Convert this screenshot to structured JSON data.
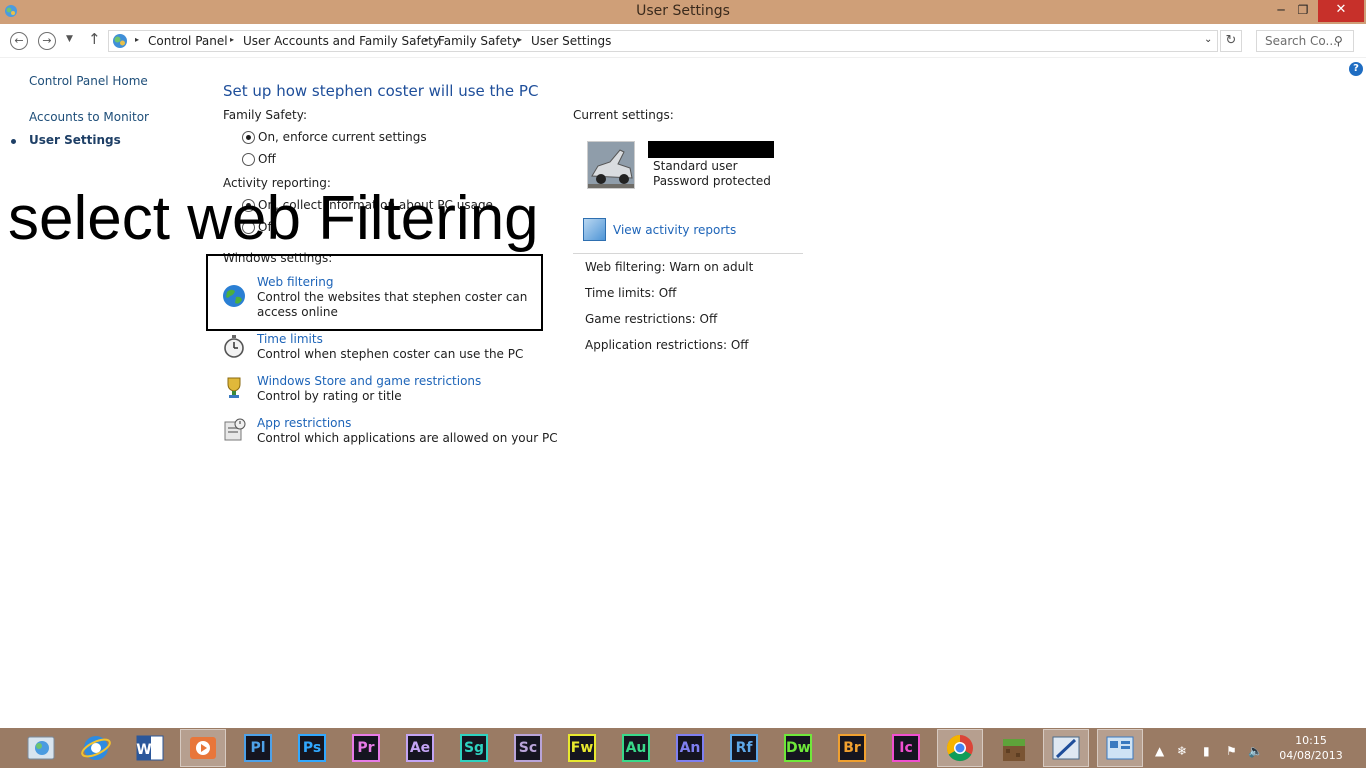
{
  "window": {
    "title": "User Settings",
    "minimize_glyph": "─",
    "maximize_glyph": "❐",
    "close_glyph": "✕"
  },
  "navbar": {
    "back_glyph": "←",
    "forward_glyph": "→",
    "recent_glyph": "▼",
    "up_glyph": "↑",
    "breadcrumbs": [
      "Control Panel",
      "User Accounts and Family Safety",
      "Family Safety",
      "User Settings"
    ],
    "separator_glyph": "▸",
    "dropdown_glyph": "⌄",
    "refresh_glyph": "↻",
    "search_placeholder": "Search Co...",
    "search_glyph": "⚲"
  },
  "sidebar": {
    "items": [
      {
        "label": "Control Panel Home"
      },
      {
        "label": "Accounts to Monitor"
      },
      {
        "label": "User Settings"
      }
    ],
    "help_glyph": "?"
  },
  "main": {
    "heading": "Set up how stephen coster will use the PC",
    "family_safety": {
      "label": "Family Safety:",
      "options": [
        "On, enforce current settings",
        "Off"
      ],
      "selected": "On, enforce current settings"
    },
    "activity_reporting": {
      "label": "Activity reporting:",
      "options": [
        "On, collect information about PC usage",
        "Off"
      ],
      "selected": "On, collect information about PC usage"
    },
    "windows_settings": {
      "label": "Windows settings:",
      "items": [
        {
          "title": "Web filtering",
          "description": "Control the websites that stephen coster can access online",
          "icon": "globe-icon"
        },
        {
          "title": "Time limits",
          "description": "Control when stephen coster can use the PC",
          "icon": "stopwatch-icon"
        },
        {
          "title": "Windows Store and game restrictions",
          "description": "Control by rating or title",
          "icon": "trophy-icon"
        },
        {
          "title": "App restrictions",
          "description": "Control which applications are allowed on your PC",
          "icon": "app-restrictions-icon"
        }
      ]
    },
    "overlay_annotation": "select web Filtering"
  },
  "current_settings": {
    "label": "Current settings:",
    "account_type": "Standard user",
    "password_status": "Password protected",
    "view_reports": "View activity reports",
    "settings": [
      {
        "name": "Web filtering:",
        "value": "Warn on adult"
      },
      {
        "name": "Time limits:",
        "value": "Off"
      },
      {
        "name": "Game restrictions:",
        "value": "Off"
      },
      {
        "name": "Application restrictions:",
        "value": "Off"
      }
    ]
  },
  "taskbar": {
    "adobe_apps": [
      {
        "label": "Pl",
        "color": "#4ea1e8"
      },
      {
        "label": "Ps",
        "color": "#31a8ff"
      },
      {
        "label": "Pr",
        "color": "#e77be8"
      },
      {
        "label": "Ae",
        "color": "#c3a4f4"
      },
      {
        "label": "Sg",
        "color": "#2ed2c0"
      },
      {
        "label": "Sc",
        "color": "#b9a4d9"
      },
      {
        "label": "Fw",
        "color": "#e8e82e"
      },
      {
        "label": "Au",
        "color": "#39d98a"
      },
      {
        "label": "An",
        "color": "#7f7ff0"
      },
      {
        "label": "Rf",
        "color": "#5ea8e8"
      },
      {
        "label": "Dw",
        "color": "#6fe83a"
      },
      {
        "label": "Br",
        "color": "#f0a030"
      },
      {
        "label": "Ic",
        "color": "#f04fd0"
      }
    ],
    "tray_glyphs": {
      "show_hidden": "▲",
      "weather": "❄",
      "battery": "▮",
      "network": "⚑",
      "volume": "🔈"
    },
    "clock_time": "10:15",
    "clock_date": "04/08/2013"
  }
}
